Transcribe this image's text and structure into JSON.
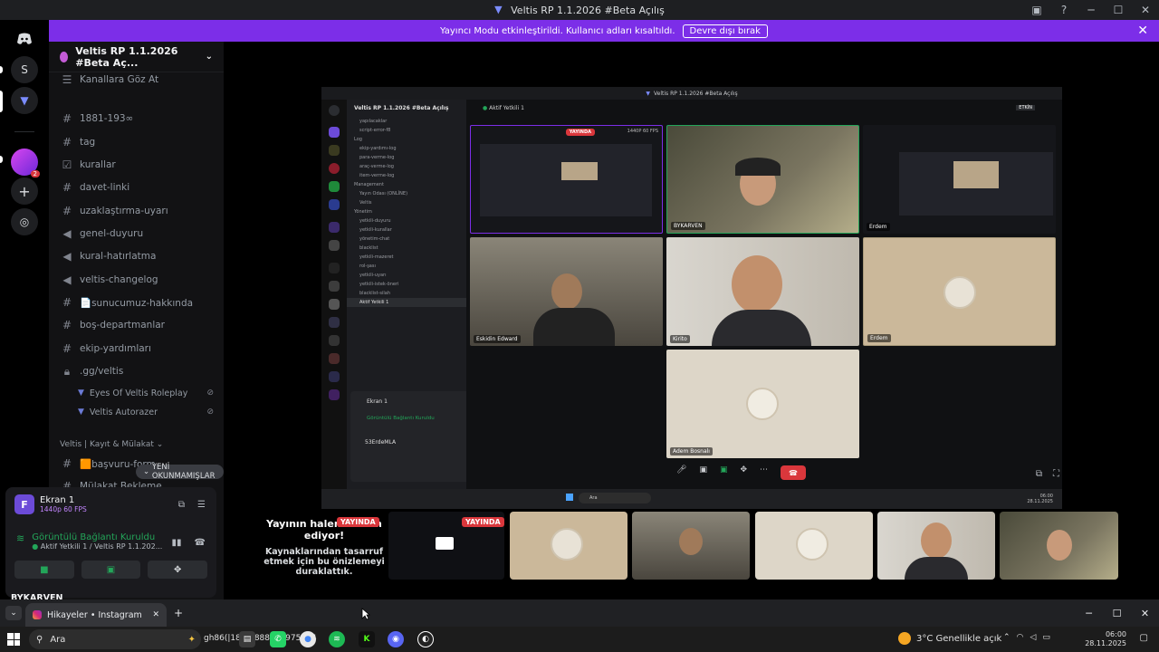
{
  "window": {
    "title": "Veltis RP 1.1.2026 #Beta Açılış"
  },
  "banner": {
    "text": "Yayıncı Modu etkinleştirildi. Kullanıcı adları kısaltıldı.",
    "button": "Devre dışı bırak"
  },
  "rail": {
    "server_s": "S",
    "badge": "2"
  },
  "sidebar": {
    "guild_name": "Veltis RP 1.1.2026 #Beta Aç...",
    "channels": [
      {
        "label": "Kanallara Göz At",
        "icon": "browse-icon"
      },
      {
        "label": "1881-193∞",
        "icon": "hash-icon"
      },
      {
        "label": "tag",
        "icon": "hash-icon"
      },
      {
        "label": "kurallar",
        "icon": "rules-icon"
      },
      {
        "label": "davet-linki",
        "icon": "hash-icon"
      },
      {
        "label": "uzaklaştırma-uyarı",
        "icon": "hash-icon"
      },
      {
        "label": "genel-duyuru",
        "icon": "announcement-icon"
      },
      {
        "label": "kural-hatırlatma",
        "icon": "announcement-icon"
      },
      {
        "label": "veltis-changelog",
        "icon": "announcement-icon"
      },
      {
        "label": "📄sunucumuz-hakkında",
        "icon": "hash-icon"
      },
      {
        "label": "boş-departmanlar",
        "icon": "hash-icon"
      },
      {
        "label": "ekip-yardımları",
        "icon": "hash-icon"
      },
      {
        "label": ".gg/veltis",
        "icon": "lock-icon"
      }
    ],
    "sub_channels": [
      {
        "label": "Eyes Of Veltis Roleplay"
      },
      {
        "label": "Veltis Autorazer"
      }
    ],
    "category": "Veltis | Kayıt & Mülakat",
    "bottom_channels": [
      {
        "label": "🟧başvuru-form"
      },
      {
        "label": "Mülakat Bekleme"
      }
    ],
    "new_unread": "YENİ OKUNMAMIŞLAR"
  },
  "voice_panel": {
    "ekran_title": "Ekran 1",
    "ekran_sub": "1440p 60 FPS",
    "status": "Görüntülü Bağlantı Kuruldu",
    "status_sub": "Aktif Yetkili 1 / Veltis RP 1.1.202...",
    "user": "BYKARVEN"
  },
  "stream": {
    "inner_title": "Veltis RP 1.1.2026 #Beta Açılış",
    "inner_guild": "Veltis RP 1.1.2026 #Beta Açılış",
    "inner_channel": "Aktif Yetkili 1",
    "inner_live_btn": "ETKİN",
    "inner_side_lines": [
      "yapılacaklar",
      "script-error-f8",
      "Log",
      "ekip-yardımı-log",
      "para-verme-log",
      "araç-verme-log",
      "item-verme-log",
      "Management",
      "Yayın Odası (ONLİNE)",
      "Veltis",
      "Yönetim",
      "yetkili-duyuru",
      "yetkili-kurallar",
      "yönetim-chat",
      "blacklist",
      "yetkili-mazeret",
      "rol-şası",
      "yetkili-uyarı",
      "yetkili-istek-öneri",
      "blacklist-silah",
      "Aktif Yetkili 1"
    ],
    "inner_ekran": "Ekran 1",
    "inner_status": "Görüntülü Bağlantı Kuruldu",
    "inner_user": "53ErdeMLA",
    "tiles": [
      {
        "label": "BYKARVEN"
      },
      {
        "label": "Erdem"
      },
      {
        "label": "Eskidin Edward"
      },
      {
        "label": "Kirito"
      },
      {
        "label": "Erdem"
      },
      {
        "label": "Adem Bosnalı"
      }
    ],
    "tile_live": "YAYINDA",
    "tile_quality": "1440P 60 FPS",
    "inner_search": "Ara",
    "inner_clock_time": "06:00",
    "inner_clock_date": "28.11.2025"
  },
  "strip": {
    "live": "YAYINDA",
    "paused_title": "Yayının halen devam ediyor!",
    "paused_sub": "Kaynaklarından tasarruf etmek için bu önizlemeyi duraklattık."
  },
  "browser": {
    "tab_title": "Hikayeler • Instagram"
  },
  "taskbar": {
    "search": "Ara",
    "weather": "3°C  Genellikle açık",
    "time": "06:00",
    "date": "28.11.2025",
    "overlay_text": "gh86(|1806)888788975064"
  }
}
